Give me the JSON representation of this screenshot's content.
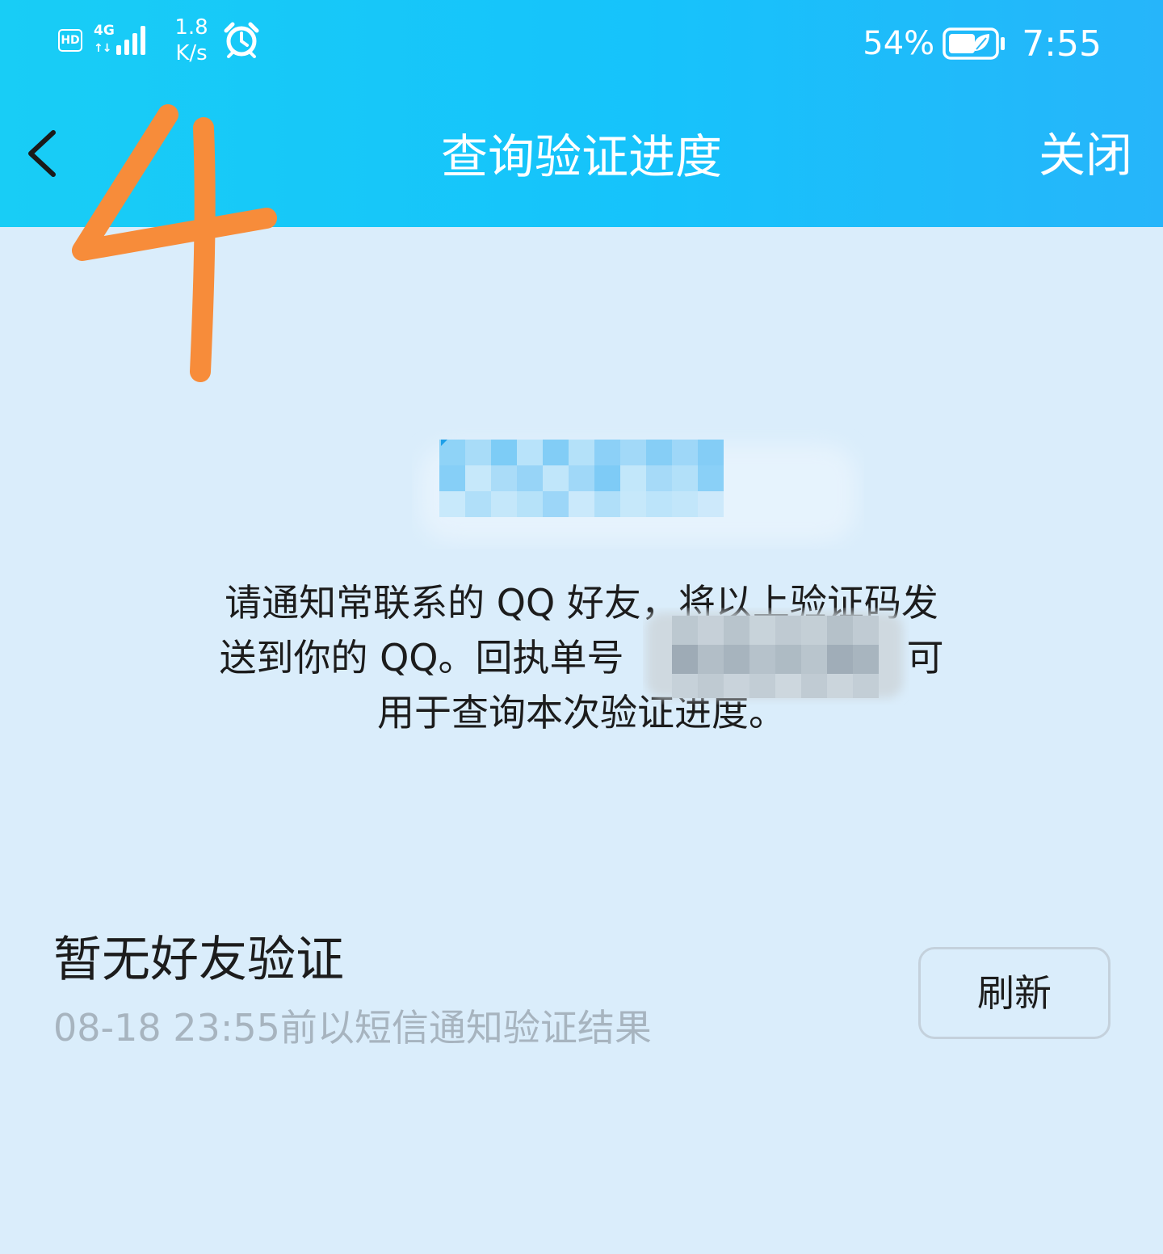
{
  "status_bar": {
    "hd_label": "HD",
    "network_type": "4G",
    "network_arrows": "↑↓",
    "speed_value": "1.8",
    "speed_unit": "K/s",
    "alarm_icon": "alarm-clock-icon",
    "battery_percent": "54%",
    "battery_icon": "battery-leaf-icon",
    "time": "7:55"
  },
  "nav": {
    "back_icon": "chevron-left-icon",
    "title": "查询验证进度",
    "close_label": "关闭"
  },
  "annotation": {
    "text": "4",
    "color": "#f78c3a"
  },
  "verification": {
    "code_masked": true,
    "instruction_line1": "请通知常联系的 QQ 好友，将以上验证码发",
    "instruction_line2_prefix": "送到你的 QQ。回执单号",
    "instruction_line2_suffix": "可",
    "instruction_line3": "用于查询本次验证进度。"
  },
  "status": {
    "title": "暂无好友验证",
    "subtitle": "08-18 23:55前以短信通知验证结果",
    "refresh_label": "刷新"
  },
  "colors": {
    "header_start": "#18cdf6",
    "header_end": "#26b5fa",
    "background": "#daedfb",
    "subtitle_gray": "#a7b4bf"
  }
}
